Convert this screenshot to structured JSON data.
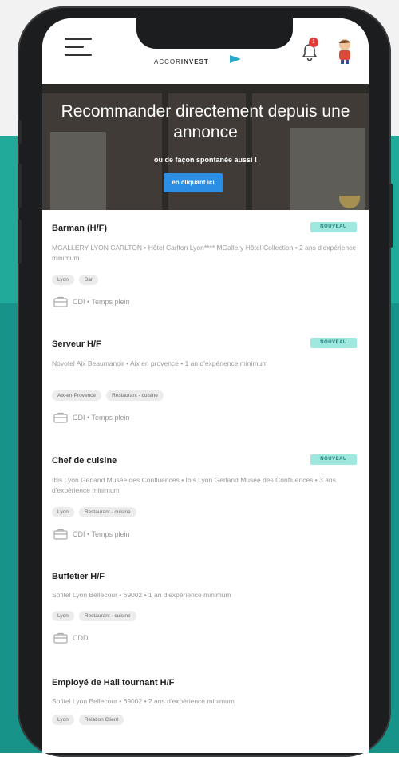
{
  "app": {
    "brand_light": "ACCOR",
    "brand_bold": "INVEST",
    "notification_count": "1",
    "accent_color": "#2d8ee6",
    "badge_color": "#9fe8e0",
    "background_color": "#1faa9a"
  },
  "hero": {
    "title": "Recommander directement depuis une annonce",
    "subtitle": "ou de façon spontanée aussi !",
    "button_label": "en cliquant ici"
  },
  "jobs": [
    {
      "title": "Barman (H/F)",
      "badge": "NOUVEAU",
      "meta": "MGALLERY LYON CARLTON • Hôtel Carlton Lyon**** MGallery Hôtel Collection • 2 ans d'expérience minimum",
      "tags": [
        "Lyon",
        "Bar"
      ],
      "contract": "CDI • Temps plein"
    },
    {
      "title": "Serveur H/F",
      "badge": "NOUVEAU",
      "meta": "Novotel Aix Beaumanoir • Aix en provence • 1 an d'expérience minimum",
      "tags": [
        "Aix-en-Provence",
        "Restaurant - cuisine"
      ],
      "contract": "CDI • Temps plein"
    },
    {
      "title": "Chef de cuisine",
      "badge": "NOUVEAU",
      "meta": "Ibis Lyon Gerland Musée des Confluences • Ibis Lyon Gerland Musée des Confluences • 3 ans d'expérience minimum",
      "tags": [
        "Lyon",
        "Restaurant - cuisine"
      ],
      "contract": "CDI • Temps plein"
    },
    {
      "title": "Buffetier H/F",
      "badge": "",
      "meta": "Sofitel Lyon Bellecour • 69002 • 1 an d'expérience minimum",
      "tags": [
        "Lyon",
        "Restaurant - cuisine"
      ],
      "contract": "CDD"
    },
    {
      "title": "Employé de Hall tournant H/F",
      "badge": "",
      "meta": "Sofitel Lyon Bellecour • 69002 • 2 ans d'expérience minimum",
      "tags": [
        "Lyon",
        "Relation Client"
      ],
      "contract": ""
    }
  ]
}
